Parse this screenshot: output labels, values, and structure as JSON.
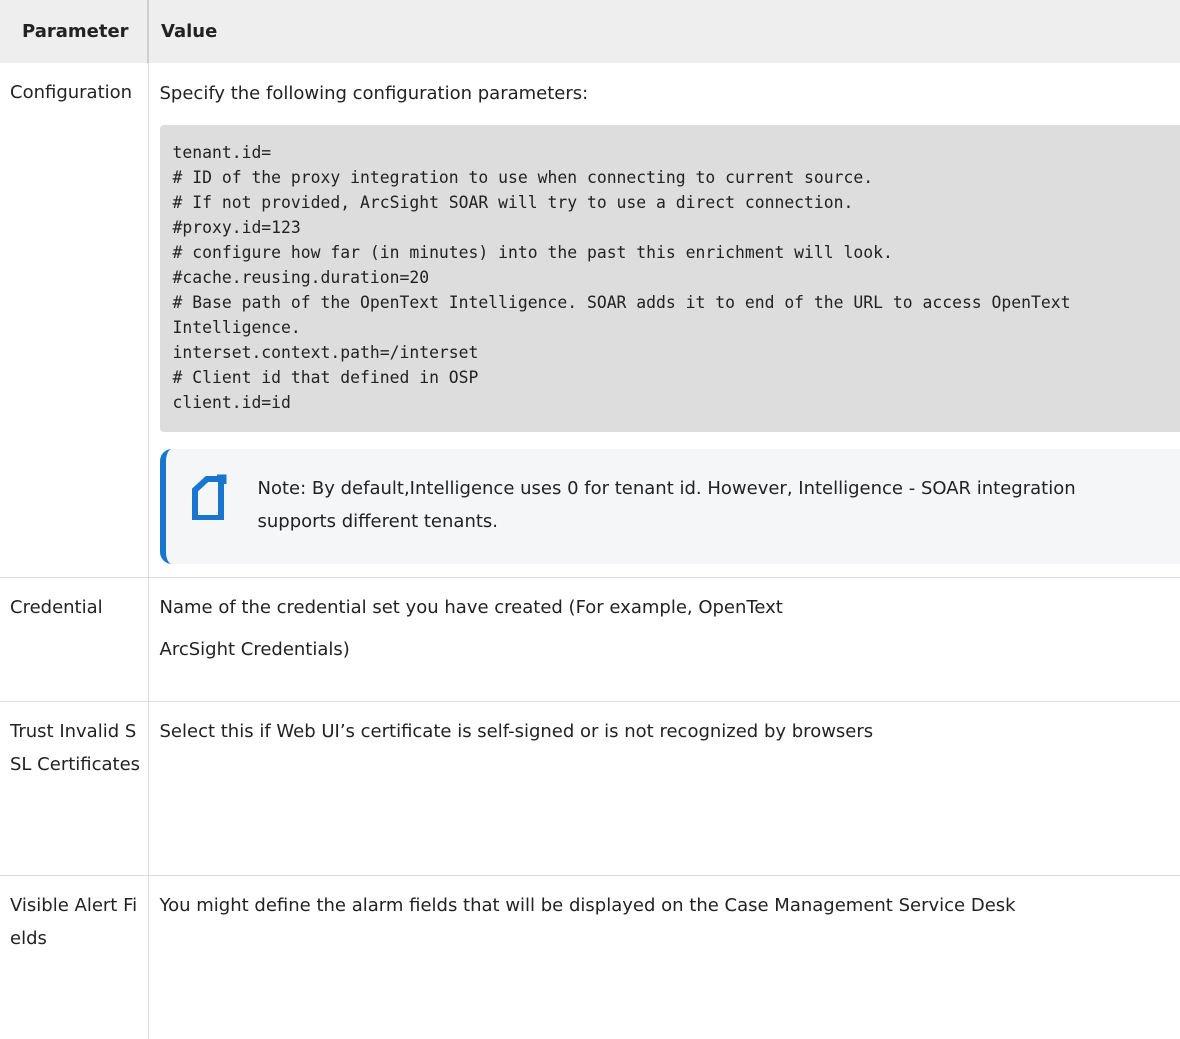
{
  "table": {
    "headers": {
      "parameter": "Parameter",
      "value": "Value"
    },
    "rows": {
      "configuration": {
        "parameter": "Configuration",
        "intro": "Specify the following configuration parameters:",
        "code_lines": [
          "tenant.id=",
          "# ID of the proxy integration to use when connecting to current source.",
          "# If not provided, ArcSight SOAR will try to use a direct connection.",
          "#proxy.id=123",
          "# configure how far (in minutes) into the past this enrichment will look.",
          "#cache.reusing.duration=20",
          "# Base path of the OpenText Intelligence. SOAR adds it to end of the URL to access OpenText Intelligence.",
          "interset.context.path=/interset",
          "# Client id that defined in OSP",
          "client.id=id"
        ],
        "note": {
          "icon": "note-icon",
          "text": "Note: By default,Intelligence uses 0 for tenant id. However, Intelligence - SOAR integration supports different tenants."
        }
      },
      "credential": {
        "parameter": "Credential",
        "value_line1": "Name of the credential set you have created (For example, OpenText",
        "value_line2": "ArcSight Credentials)"
      },
      "trust_ssl": {
        "parameter": "Trust Invalid SSL Certificates",
        "value": "Select this if Web UI’s certificate is self-signed or is not recognized by browsers"
      },
      "visible_alert_fields": {
        "parameter": "Visible Alert Fields",
        "value": "You might define the alarm fields that will be displayed on the Case Management Service Desk"
      }
    }
  },
  "colors": {
    "header_bg": "#eeeeee",
    "code_bg": "#dddddd",
    "note_bg": "#f4f6f8",
    "note_accent": "#1a75ce"
  }
}
